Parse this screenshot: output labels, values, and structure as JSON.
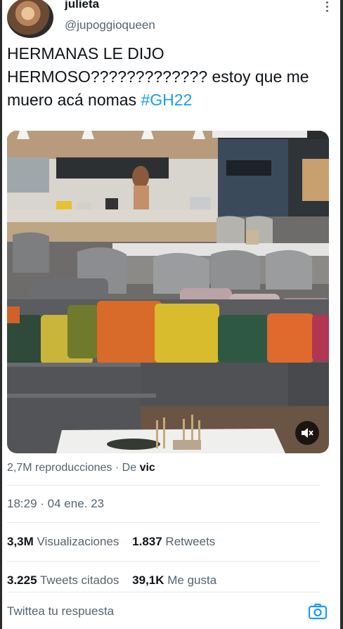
{
  "user": {
    "display_name": "julieta",
    "handle": "@jupoggioqueen"
  },
  "tweet": {
    "text_main": "HERMANAS LE DIJO HERMOSO????????????? estoy que me muero acá nomas ",
    "hashtag": "#GH22"
  },
  "media": {
    "mute_icon": "speaker-muted-icon"
  },
  "views": {
    "count": "2,7M reproducciones",
    "separator": "·",
    "from_label": "De",
    "from_name": "vic"
  },
  "timestamp": "18:29 · 04 ene. 23",
  "stats": {
    "views_value": "3,3M",
    "views_label": "Visualizaciones",
    "retweets_value": "1.837",
    "retweets_label": "Retweets",
    "quotes_value": "3.225",
    "quotes_label": "Tweets citados",
    "likes_value": "39,1K",
    "likes_label": "Me gusta"
  },
  "reply": {
    "placeholder": "Twittea tu respuesta",
    "camera_icon": "camera-icon"
  },
  "colors": {
    "link": "#1d9bf0",
    "secondary_text": "#536471",
    "divider": "#e1e8ed"
  }
}
